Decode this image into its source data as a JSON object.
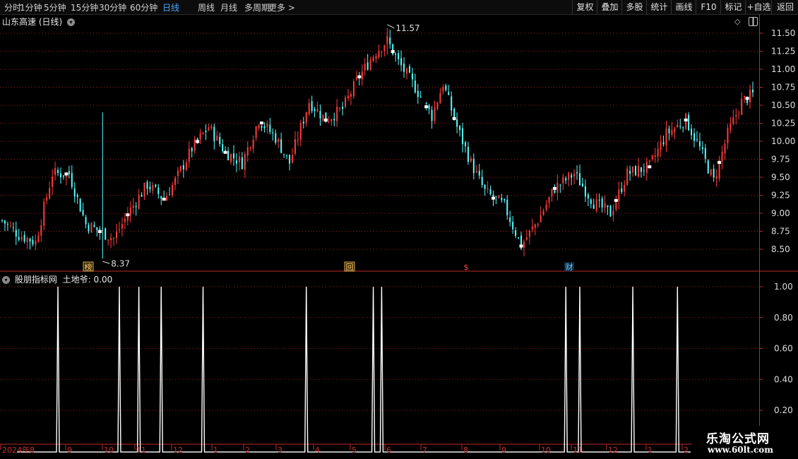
{
  "toolbar": {
    "periods": [
      "分时",
      "1分钟",
      "5分钟",
      "15分钟",
      "30分钟",
      "60分钟",
      "日线",
      "周线",
      "月线",
      "多周期",
      "更多 >"
    ],
    "active_period": "日线",
    "actions": [
      "复权",
      "叠加",
      "多股",
      "统计",
      "画线",
      "F10",
      "标记",
      "+自选",
      "返回"
    ]
  },
  "main_panel": {
    "title": "山东高速 (日线)",
    "high_label": "11.57",
    "low_label": "8.37",
    "y_ticks": [
      "11.50",
      "11.25",
      "11.00",
      "10.75",
      "10.50",
      "10.25",
      "10.00",
      "9.75",
      "9.50",
      "9.25",
      "9.00",
      "8.75",
      "8.50"
    ],
    "markers": [
      "榜",
      "回",
      "$",
      "财"
    ]
  },
  "indicator_panel": {
    "title": "股朋指标网",
    "value_label": "土地爷: 0.00",
    "y_ticks": [
      "1.00",
      "0.80",
      "0.60",
      "0.40",
      "0.20"
    ]
  },
  "x_axis": {
    "labels": [
      "2024年8",
      "9",
      "10",
      "11",
      "12",
      "1",
      "2",
      "3",
      "4",
      "5",
      "6",
      "7",
      "8",
      "9",
      "10",
      "11",
      "12",
      "1",
      "2"
    ]
  },
  "watermark": {
    "title": "乐淘公式网",
    "url": "www.60lt.com"
  },
  "colors": {
    "up": "#ff3b3b",
    "down": "#54ffff",
    "axis": "#c0282d",
    "signal": "#ffffff",
    "active": "#4aa8ff"
  },
  "chart_data": [
    {
      "type": "candlestick",
      "ylim": [
        8.3,
        11.65
      ],
      "series_anchors": [
        {
          "d": 0,
          "v": 8.9
        },
        {
          "d": 6,
          "v": 8.7
        },
        {
          "d": 12,
          "v": 8.6
        },
        {
          "d": 18,
          "v": 9.55
        },
        {
          "d": 24,
          "v": 9.55
        },
        {
          "d": 30,
          "v": 8.85
        },
        {
          "d": 35,
          "v": 8.75
        },
        {
          "d": 40,
          "v": 8.65
        },
        {
          "d": 46,
          "v": 9.05
        },
        {
          "d": 52,
          "v": 9.4
        },
        {
          "d": 58,
          "v": 9.2
        },
        {
          "d": 62,
          "v": 9.45
        },
        {
          "d": 68,
          "v": 9.9
        },
        {
          "d": 74,
          "v": 10.2
        },
        {
          "d": 80,
          "v": 9.85
        },
        {
          "d": 86,
          "v": 9.7
        },
        {
          "d": 92,
          "v": 10.3
        },
        {
          "d": 98,
          "v": 10.05
        },
        {
          "d": 103,
          "v": 9.7
        },
        {
          "d": 110,
          "v": 10.55
        },
        {
          "d": 116,
          "v": 10.3
        },
        {
          "d": 122,
          "v": 10.45
        },
        {
          "d": 128,
          "v": 10.9
        },
        {
          "d": 134,
          "v": 11.25
        },
        {
          "d": 138,
          "v": 11.4
        },
        {
          "d": 142,
          "v": 11.1
        },
        {
          "d": 148,
          "v": 10.75
        },
        {
          "d": 154,
          "v": 10.35
        },
        {
          "d": 158,
          "v": 10.8
        },
        {
          "d": 163,
          "v": 10.2
        },
        {
          "d": 168,
          "v": 9.7
        },
        {
          "d": 173,
          "v": 9.3
        },
        {
          "d": 180,
          "v": 9.1
        },
        {
          "d": 186,
          "v": 8.55
        },
        {
          "d": 192,
          "v": 8.9
        },
        {
          "d": 198,
          "v": 9.35
        },
        {
          "d": 205,
          "v": 9.55
        },
        {
          "d": 212,
          "v": 9.15
        },
        {
          "d": 218,
          "v": 9.0
        },
        {
          "d": 224,
          "v": 9.55
        },
        {
          "d": 232,
          "v": 9.65
        },
        {
          "d": 238,
          "v": 10.1
        },
        {
          "d": 245,
          "v": 10.3
        },
        {
          "d": 250,
          "v": 9.9
        },
        {
          "d": 255,
          "v": 9.45
        },
        {
          "d": 260,
          "v": 10.1
        },
        {
          "d": 265,
          "v": 10.55
        },
        {
          "d": 269,
          "v": 10.65
        }
      ],
      "high": 11.57,
      "low": 8.37
    },
    {
      "type": "line",
      "name": "土地爷",
      "ylim": [
        0,
        1.0
      ],
      "spikes_day_index": [
        20,
        42,
        49,
        57,
        72,
        109,
        133,
        136,
        202,
        207,
        226,
        242
      ]
    }
  ]
}
